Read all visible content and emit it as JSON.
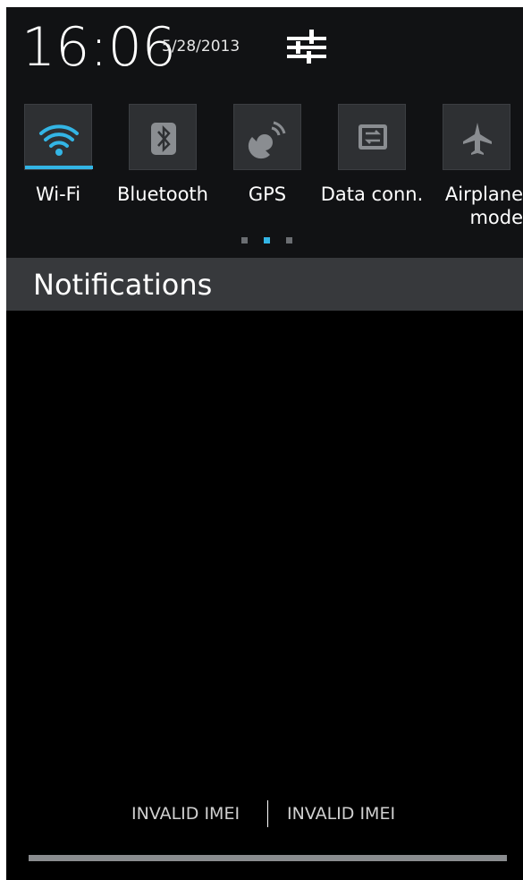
{
  "header": {
    "time": "16:06",
    "date": "5/28/2013",
    "settings_icon": "settings-sliders-icon"
  },
  "quick_settings": {
    "tiles": [
      {
        "label": "Wi-Fi",
        "icon": "wifi-icon",
        "active": true
      },
      {
        "label": "Bluetooth",
        "icon": "bluetooth-icon",
        "active": false
      },
      {
        "label": "GPS",
        "icon": "gps-icon",
        "active": false
      },
      {
        "label": "Data conn.",
        "icon": "data-connection-icon",
        "active": false
      },
      {
        "label_line1": "Airplane",
        "label_line2": "mode",
        "icon": "airplane-icon",
        "active": false
      }
    ],
    "page_indicator": {
      "pages": 3,
      "current": 2
    }
  },
  "notifications": {
    "title": "Notifications"
  },
  "carrier": {
    "sim1": "INVALID IMEI",
    "sim2": "INVALID IMEI"
  },
  "colors": {
    "accent": "#33b5e5",
    "tile_bg": "#2e3033",
    "notif_bar_bg": "#37393c"
  }
}
